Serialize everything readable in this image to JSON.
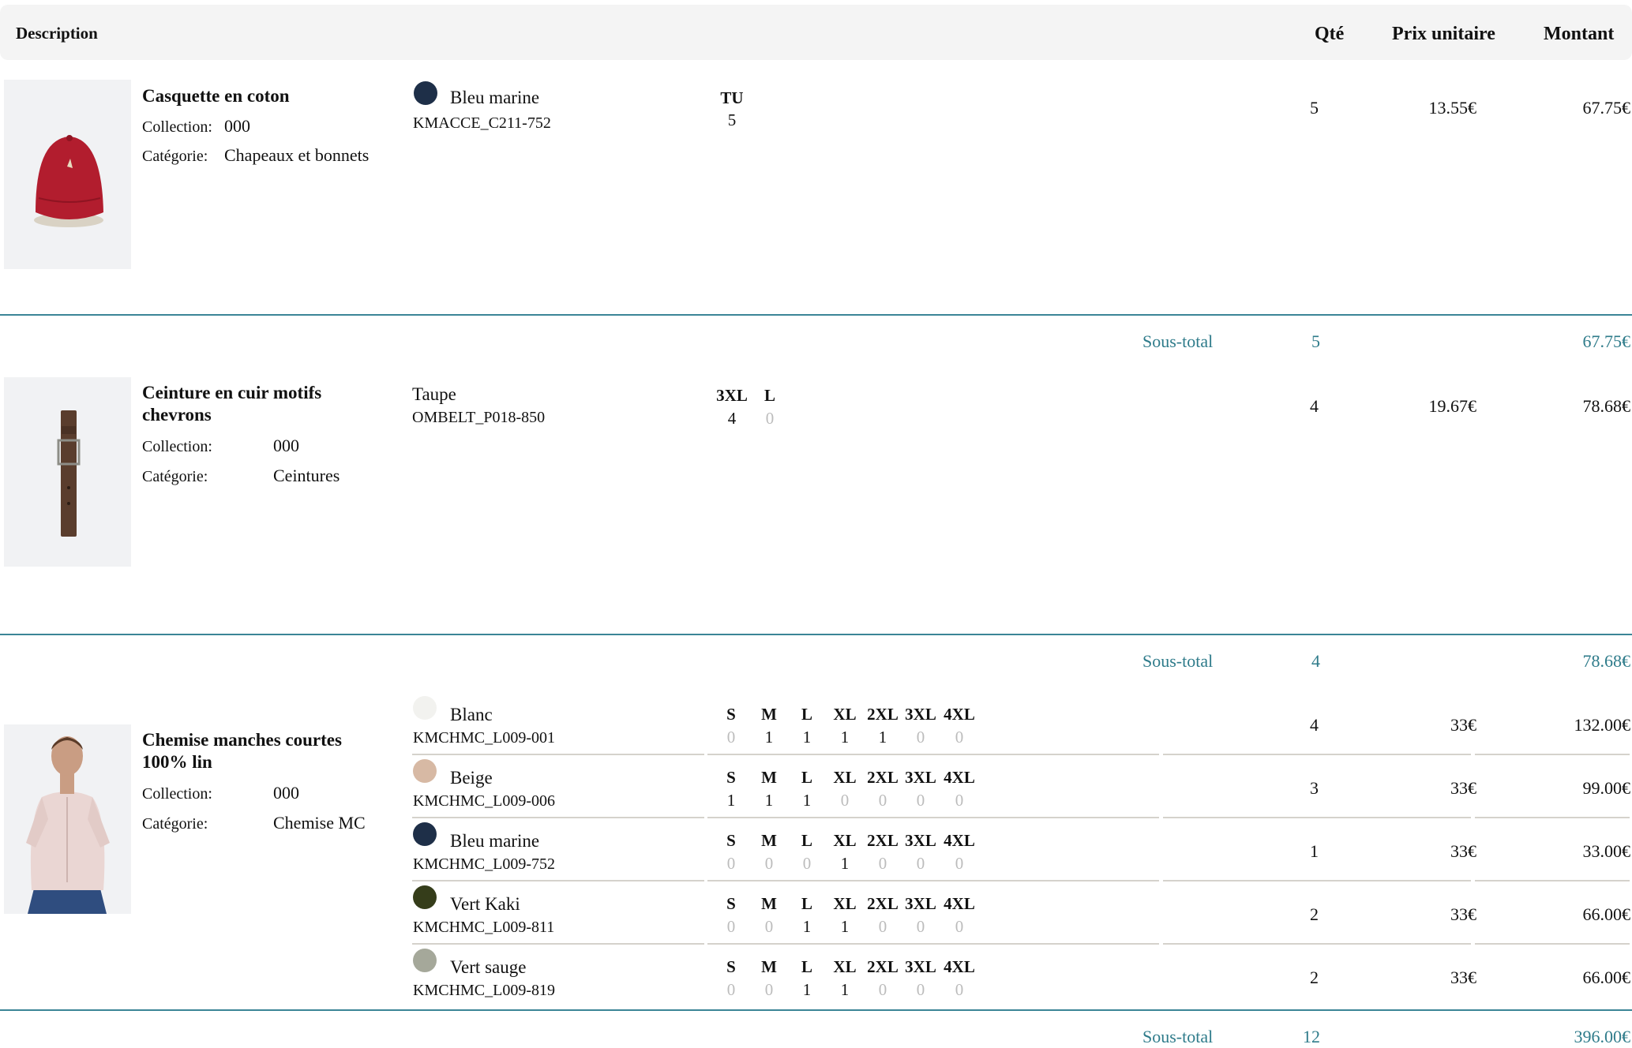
{
  "header": {
    "description": "Description",
    "qte": "Qté",
    "prix_unitaire": "Prix unitaire",
    "montant": "Montant"
  },
  "labels": {
    "collection": "Collection:",
    "categorie": "Catégorie:",
    "sous_total": "Sous-total"
  },
  "products": [
    {
      "name": "Casquette en coton",
      "collection": "000",
      "categorie": "Chapeaux et bonnets",
      "variants": [
        {
          "color_name": "Bleu marine",
          "swatch": "#1e2f48",
          "ref": "KMACCE_C211-752",
          "sizes": [
            "TU"
          ],
          "quantities": [
            "5"
          ],
          "qte": "5",
          "prix": "13.55€",
          "montant": "67.75€"
        }
      ],
      "subtotal_qty": "5",
      "subtotal_amount": "67.75€"
    },
    {
      "name": "Ceinture en cuir motifs chevrons",
      "collection": "000",
      "categorie": "Ceintures",
      "variants": [
        {
          "color_name": "Taupe",
          "swatch": null,
          "ref": "OMBELT_P018-850",
          "sizes": [
            "3XL",
            "L"
          ],
          "quantities": [
            "4",
            "0"
          ],
          "qte": "4",
          "prix": "19.67€",
          "montant": "78.68€"
        }
      ],
      "subtotal_qty": "4",
      "subtotal_amount": "78.68€"
    },
    {
      "name": "Chemise manches courtes 100% lin",
      "collection": "000",
      "categorie": "Chemise MC",
      "variants": [
        {
          "color_name": "Blanc",
          "swatch": "#f2f2ef",
          "ref": "KMCHMC_L009-001",
          "sizes": [
            "S",
            "M",
            "L",
            "XL",
            "2XL",
            "3XL",
            "4XL"
          ],
          "quantities": [
            "0",
            "1",
            "1",
            "1",
            "1",
            "0",
            "0"
          ],
          "qte": "4",
          "prix": "33€",
          "montant": "132.00€"
        },
        {
          "color_name": "Beige",
          "swatch": "#d7b9a4",
          "ref": "KMCHMC_L009-006",
          "sizes": [
            "S",
            "M",
            "L",
            "XL",
            "2XL",
            "3XL",
            "4XL"
          ],
          "quantities": [
            "1",
            "1",
            "1",
            "0",
            "0",
            "0",
            "0"
          ],
          "qte": "3",
          "prix": "33€",
          "montant": "99.00€"
        },
        {
          "color_name": "Bleu marine",
          "swatch": "#1e2f48",
          "ref": "KMCHMC_L009-752",
          "sizes": [
            "S",
            "M",
            "L",
            "XL",
            "2XL",
            "3XL",
            "4XL"
          ],
          "quantities": [
            "0",
            "0",
            "0",
            "1",
            "0",
            "0",
            "0"
          ],
          "qte": "1",
          "prix": "33€",
          "montant": "33.00€"
        },
        {
          "color_name": "Vert Kaki",
          "swatch": "#353d1a",
          "ref": "KMCHMC_L009-811",
          "sizes": [
            "S",
            "M",
            "L",
            "XL",
            "2XL",
            "3XL",
            "4XL"
          ],
          "quantities": [
            "0",
            "0",
            "1",
            "1",
            "0",
            "0",
            "0"
          ],
          "qte": "2",
          "prix": "33€",
          "montant": "66.00€"
        },
        {
          "color_name": "Vert sauge",
          "swatch": "#a5a89a",
          "ref": "KMCHMC_L009-819",
          "sizes": [
            "S",
            "M",
            "L",
            "XL",
            "2XL",
            "3XL",
            "4XL"
          ],
          "quantities": [
            "0",
            "0",
            "1",
            "1",
            "0",
            "0",
            "0"
          ],
          "qte": "2",
          "prix": "33€",
          "montant": "66.00€"
        }
      ],
      "subtotal_qty": "12",
      "subtotal_amount": "396.00€"
    }
  ],
  "colors": {
    "accent": "#2e7b8a",
    "zero_qty": "#bcbcbc",
    "header_bg": "#f4f4f4"
  }
}
